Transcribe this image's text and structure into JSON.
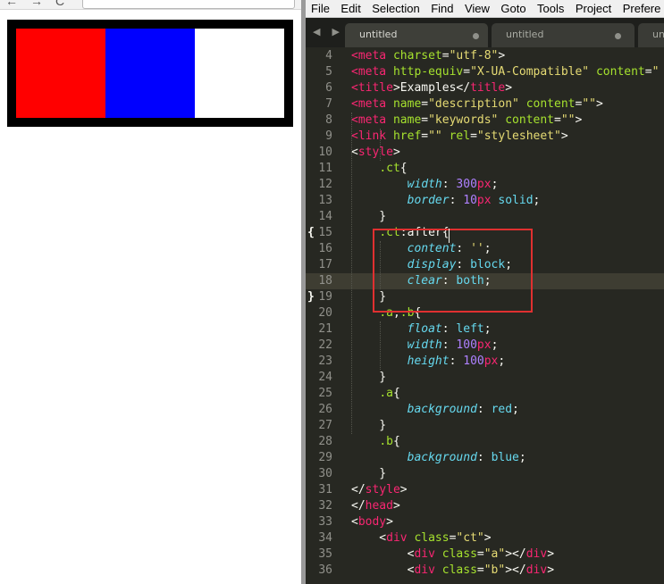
{
  "menubar": [
    "File",
    "Edit",
    "Selection",
    "Find",
    "View",
    "Goto",
    "Tools",
    "Project",
    "Prefere"
  ],
  "tabs": [
    {
      "label": "untitled",
      "active": true
    },
    {
      "label": "untitled",
      "active": false
    },
    {
      "label": "unti",
      "active": false
    }
  ],
  "browser": {
    "nav_back": "←",
    "nav_forward": "→",
    "nav_reload": "C"
  },
  "demo": {
    "color_a": "#ff0000",
    "color_b": "#0000ff",
    "border_color": "#000000"
  },
  "code_lines": [
    {
      "n": "4",
      "html": "<span class=\"t\">&lt;meta</span> <span class=\"a\">charset</span>=<span class=\"s\">\"utf-8\"</span>&gt;"
    },
    {
      "n": "5",
      "html": "<span class=\"t\">&lt;meta</span> <span class=\"a\">http-equiv</span>=<span class=\"s\">\"X-UA-Compatible\"</span> <span class=\"a\">content</span>=<span class=\"s\">\"</span>"
    },
    {
      "n": "6",
      "html": "<span class=\"t\">&lt;title</span>&gt;Examples&lt;/<span class=\"t\">title</span>&gt;"
    },
    {
      "n": "7",
      "html": "<span class=\"t\">&lt;meta</span> <span class=\"a\">name</span>=<span class=\"s\">\"description\"</span> <span class=\"a\">content</span>=<span class=\"s\">\"\"</span>&gt;"
    },
    {
      "n": "8",
      "html": "<span class=\"t\">&lt;meta</span> <span class=\"a\">name</span>=<span class=\"s\">\"keywords\"</span> <span class=\"a\">content</span>=<span class=\"s\">\"\"</span>&gt;"
    },
    {
      "n": "9",
      "html": "<span class=\"t\">&lt;link</span> <span class=\"a\">href</span>=<span class=\"s\">\"\"</span> <span class=\"a\">rel</span>=<span class=\"s\">\"stylesheet\"</span>&gt;"
    },
    {
      "n": "10",
      "html": "&lt;<span class=\"t\">style</span>&gt;"
    },
    {
      "n": "11",
      "html": "    <span class=\"a\">.ct</span>{"
    },
    {
      "n": "12",
      "html": "        <span class=\"p\">width</span>: <span class=\"n\">300</span><span class=\"k\">px</span>;"
    },
    {
      "n": "13",
      "html": "        <span class=\"p\">border</span>: <span class=\"n\">10</span><span class=\"k\">px</span> <span class=\"p\" style=\"font-style:normal\">solid</span>;"
    },
    {
      "n": "14",
      "html": "    }"
    },
    {
      "n": "15",
      "fold": "{",
      "html": "    <span class=\"a\">.ct</span>:after{"
    },
    {
      "n": "16",
      "html": "        <span class=\"p\">content</span>: <span class=\"s\">''</span>;"
    },
    {
      "n": "17",
      "html": "        <span class=\"p\">display</span>: <span class=\"p\" style=\"font-style:normal\">block</span>;"
    },
    {
      "n": "18",
      "current": true,
      "html": "        <span class=\"p\">clear</span>: <span class=\"p\" style=\"font-style:normal\">both</span>;"
    },
    {
      "n": "19",
      "fold": "}",
      "html": "    }"
    },
    {
      "n": "20",
      "html": "    <span class=\"a\">.a</span>,<span class=\"a\">.b</span>{"
    },
    {
      "n": "21",
      "html": "        <span class=\"p\">float</span>: <span class=\"p\" style=\"font-style:normal\">left</span>;"
    },
    {
      "n": "22",
      "html": "        <span class=\"p\">width</span>: <span class=\"n\">100</span><span class=\"k\">px</span>;"
    },
    {
      "n": "23",
      "html": "        <span class=\"p\">height</span>: <span class=\"n\">100</span><span class=\"k\">px</span>;"
    },
    {
      "n": "24",
      "html": "    }"
    },
    {
      "n": "25",
      "html": "    <span class=\"a\">.a</span>{"
    },
    {
      "n": "26",
      "html": "        <span class=\"p\">background</span>: <span class=\"p\" style=\"font-style:normal\">red</span>;"
    },
    {
      "n": "27",
      "html": "    }"
    },
    {
      "n": "28",
      "html": "    <span class=\"a\">.b</span>{"
    },
    {
      "n": "29",
      "html": "        <span class=\"p\">background</span>: <span class=\"p\" style=\"font-style:normal\">blue</span>;"
    },
    {
      "n": "30",
      "html": "    }"
    },
    {
      "n": "31",
      "html": "&lt;/<span class=\"t\">style</span>&gt;"
    },
    {
      "n": "32",
      "html": "&lt;/<span class=\"t\">head</span>&gt;"
    },
    {
      "n": "33",
      "html": "&lt;<span class=\"t\">body</span>&gt;"
    },
    {
      "n": "34",
      "html": "    &lt;<span class=\"t\">div</span> <span class=\"a\">class</span>=<span class=\"s\">\"ct\"</span>&gt;"
    },
    {
      "n": "35",
      "html": "        &lt;<span class=\"t\">div</span> <span class=\"a\">class</span>=<span class=\"s\">\"a\"</span>&gt;&lt;/<span class=\"t\">div</span>&gt;"
    },
    {
      "n": "36",
      "html": "        &lt;<span class=\"t\">div</span> <span class=\"a\">class</span>=<span class=\"s\">\"b\"</span>&gt;&lt;/<span class=\"t\">div</span>&gt;"
    }
  ]
}
